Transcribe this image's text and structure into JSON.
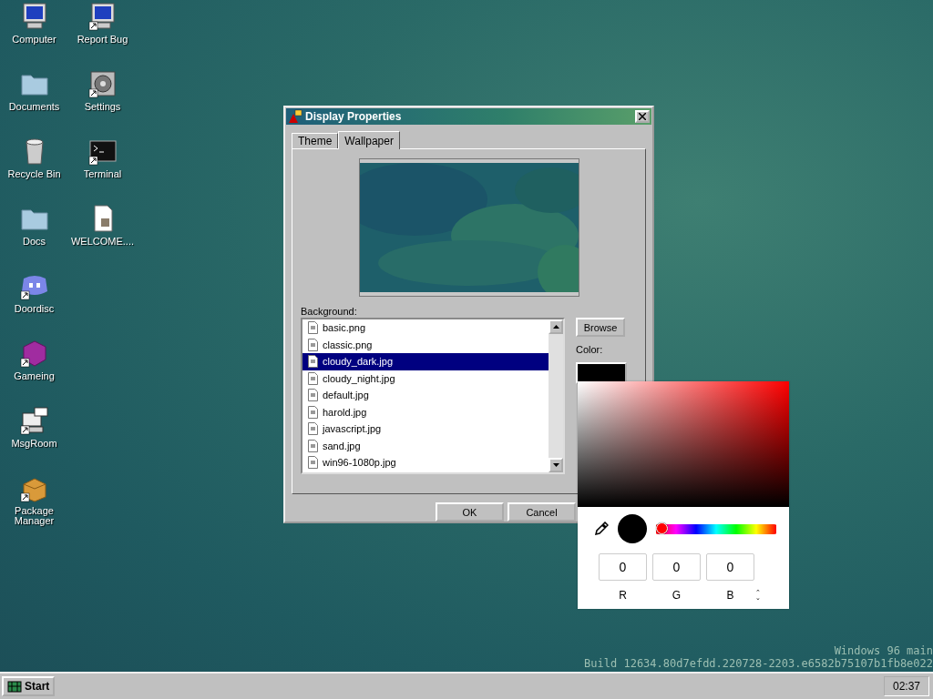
{
  "desktop_icons": [
    {
      "label": "Computer",
      "kind": "computer",
      "shortcut": false
    },
    {
      "label": "Documents",
      "kind": "folder",
      "shortcut": false
    },
    {
      "label": "Recycle Bin",
      "kind": "bin",
      "shortcut": false
    },
    {
      "label": "Docs",
      "kind": "folder",
      "shortcut": false
    },
    {
      "label": "Doordisc",
      "kind": "chat",
      "shortcut": true
    },
    {
      "label": "Gameing",
      "kind": "cube",
      "shortcut": true
    },
    {
      "label": "MsgRoom",
      "kind": "msg",
      "shortcut": true
    },
    {
      "label": "Package Manager",
      "kind": "package",
      "shortcut": true
    },
    {
      "label": "Report Bug",
      "kind": "computer",
      "shortcut": true
    },
    {
      "label": "Settings",
      "kind": "gear",
      "shortcut": true
    },
    {
      "label": "Terminal",
      "kind": "terminal",
      "shortcut": true
    },
    {
      "label": "WELCOME....",
      "kind": "document",
      "shortcut": false
    }
  ],
  "dialog": {
    "title": "Display Properties",
    "tabs": [
      {
        "label": "Theme",
        "selected": false
      },
      {
        "label": "Wallpaper",
        "selected": true
      }
    ],
    "preview": {
      "kind": "picture"
    },
    "background_label": "Background:",
    "files": [
      {
        "name": "basic.png",
        "selected": false
      },
      {
        "name": "classic.png",
        "selected": false
      },
      {
        "name": "cloudy_dark.jpg",
        "selected": true
      },
      {
        "name": "cloudy_night.jpg",
        "selected": false
      },
      {
        "name": "default.jpg",
        "selected": false
      },
      {
        "name": "harold.jpg",
        "selected": false
      },
      {
        "name": "javascript.jpg",
        "selected": false
      },
      {
        "name": "sand.jpg",
        "selected": false
      },
      {
        "name": "win96-1080p.jpg",
        "selected": false
      }
    ],
    "browse_button": "Browse",
    "color_label": "Color:",
    "buttons": [
      "OK",
      "Cancel"
    ]
  },
  "color_picker": {
    "hue": {
      "level": 0
    },
    "channels": [
      {
        "value": "0",
        "label": "R"
      },
      {
        "value": "0",
        "label": "G"
      },
      {
        "value": "0",
        "label": "B"
      }
    ],
    "toggle": "⌃⌄"
  },
  "build_info": [
    "Windows 96 main",
    "Build 12634.80d7efdd.220728-2203.e6582b75107b1fb8e022"
  ],
  "taskbar": {
    "start": "Start",
    "clock": "02:37"
  }
}
